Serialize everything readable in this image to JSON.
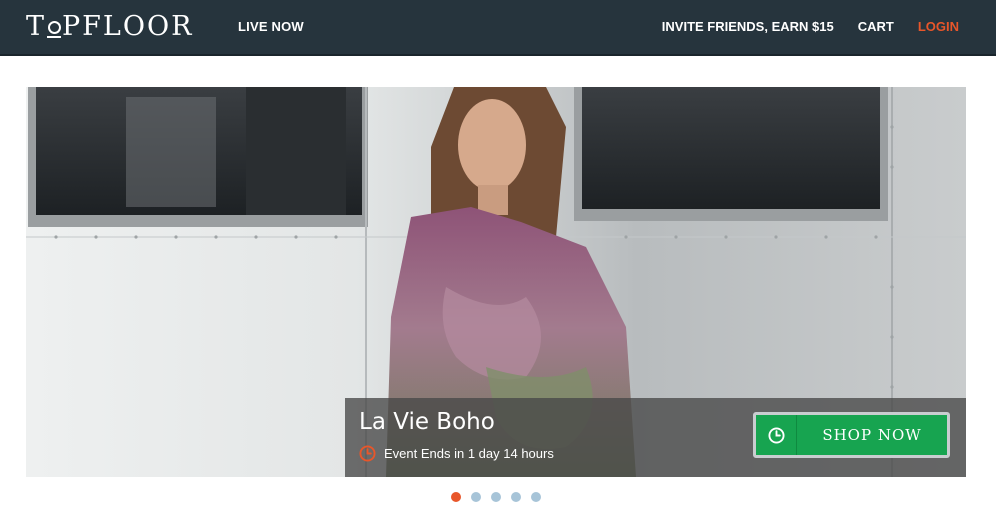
{
  "header": {
    "logo_text": "TOPFLOOR",
    "nav_left": "LIVE NOW",
    "nav_right": [
      {
        "label": "INVITE FRIENDS, EARN $15"
      },
      {
        "label": "CART"
      },
      {
        "label": "LOGIN"
      }
    ]
  },
  "hero": {
    "event_title": "La Vie Boho",
    "event_timer": "Event Ends in 1 day 14 hours",
    "shop_button_label": "SHOP NOW"
  },
  "carousel": {
    "slide_count": 5,
    "active_index": 0
  },
  "colors": {
    "header_bg": "#26343d",
    "accent": "#e8562a",
    "shop_button": "#17a450",
    "dot_inactive": "#a7c4d8"
  }
}
